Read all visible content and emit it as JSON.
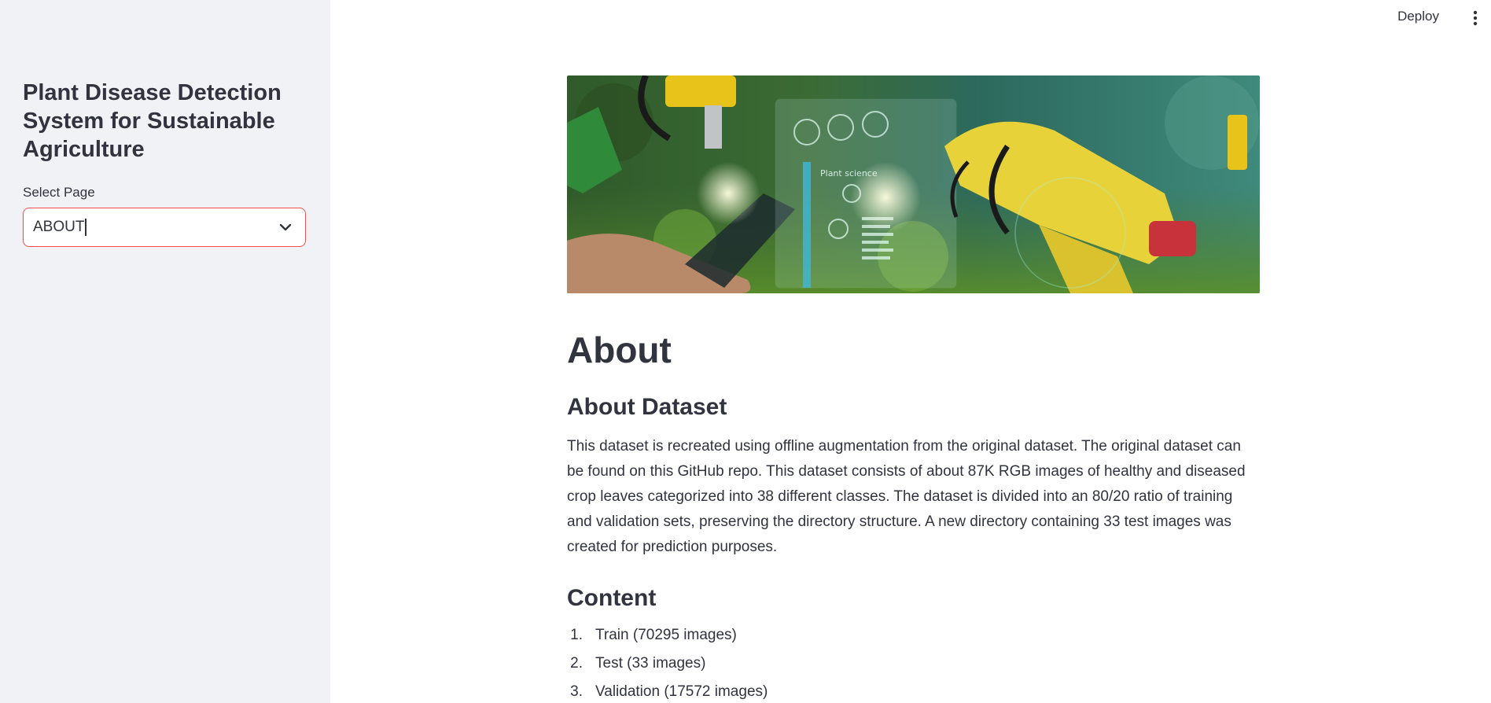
{
  "sidebar": {
    "title": "Plant Disease Detection System for Sustainable Agriculture",
    "select_label": "Select Page",
    "select_value": "ABOUT"
  },
  "header": {
    "deploy_label": "Deploy"
  },
  "main": {
    "page_title": "About",
    "dataset_heading": "About Dataset",
    "dataset_text": "This dataset is recreated using offline augmentation from the original dataset. The original dataset can be found on this GitHub repo. This dataset consists of about 87K RGB images of healthy and diseased crop leaves categorized into 38 different classes. The dataset is divided into an 80/20 ratio of training and validation sets, preserving the directory structure. A new directory containing 33 test images was created for prediction purposes.",
    "content_heading": "Content",
    "content_items": [
      {
        "num": "1.",
        "text": "Train (70295 images)"
      },
      {
        "num": "2.",
        "text": "Test (33 images)"
      },
      {
        "num": "3.",
        "text": "Validation (17572 images)"
      }
    ]
  },
  "colors": {
    "sidebar_bg": "#f0f2f6",
    "accent": "#ff4b4b",
    "text": "#31333f"
  },
  "icons": {
    "select_chevron": "chevron-down-icon",
    "menu": "kebab-menu-icon"
  }
}
